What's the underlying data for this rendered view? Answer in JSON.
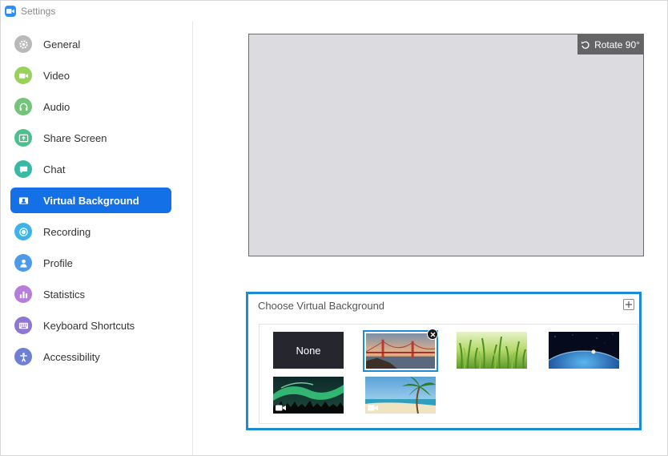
{
  "window": {
    "title": "Settings"
  },
  "sidebar": {
    "items": [
      {
        "label": "General",
        "icon": "gear-icon",
        "color": "#b9b9b9"
      },
      {
        "label": "Video",
        "icon": "video-camera-icon",
        "color": "#9ad15b"
      },
      {
        "label": "Audio",
        "icon": "headphones-icon",
        "color": "#74c47a"
      },
      {
        "label": "Share Screen",
        "icon": "share-screen-icon",
        "color": "#4dbf8c"
      },
      {
        "label": "Chat",
        "icon": "chat-bubble-icon",
        "color": "#37b9a6"
      },
      {
        "label": "Virtual Background",
        "icon": "person-card-icon",
        "color": "#1470e6",
        "active": true
      },
      {
        "label": "Recording",
        "icon": "record-icon",
        "color": "#3fb2e8"
      },
      {
        "label": "Profile",
        "icon": "person-icon",
        "color": "#4d9be6"
      },
      {
        "label": "Statistics",
        "icon": "bar-chart-icon",
        "color": "#b57fd9"
      },
      {
        "label": "Keyboard Shortcuts",
        "icon": "keyboard-icon",
        "color": "#8f76d3"
      },
      {
        "label": "Accessibility",
        "icon": "accessibility-icon",
        "color": "#6f7fd4"
      }
    ]
  },
  "preview": {
    "rotate_label": "Rotate 90°"
  },
  "virtual_background": {
    "title": "Choose Virtual Background",
    "thumbnails": [
      {
        "label": "None",
        "kind": "none"
      },
      {
        "kind": "golden-gate-bridge",
        "selected": true
      },
      {
        "kind": "grass"
      },
      {
        "kind": "earth-from-space"
      },
      {
        "kind": "aurora",
        "video": true
      },
      {
        "kind": "beach-palm",
        "video": true
      }
    ]
  },
  "colors": {
    "accent": "#1470e6",
    "panel_border": "#1b8bd3",
    "preview_bg": "#dcdce0"
  }
}
